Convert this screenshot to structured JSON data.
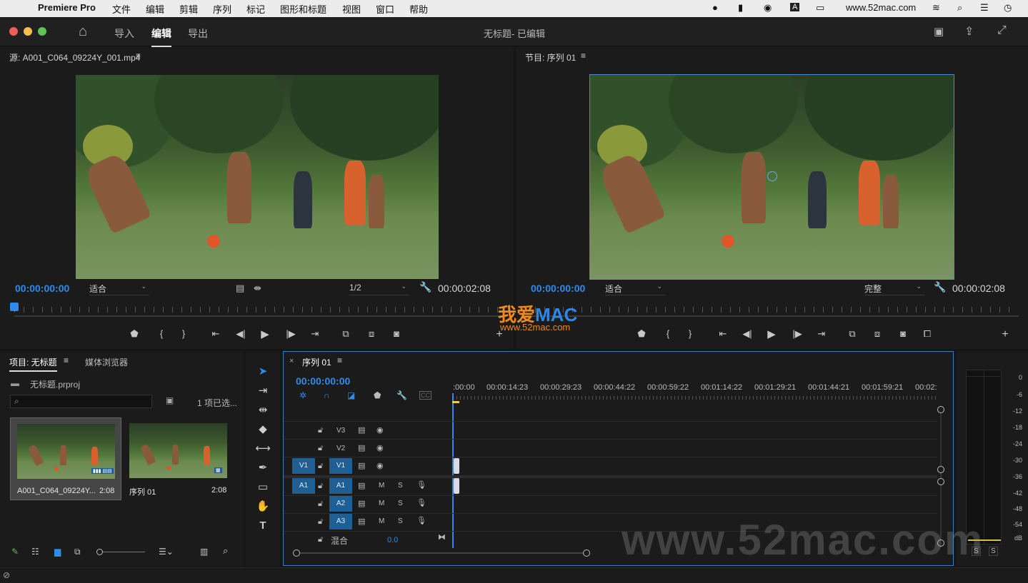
{
  "menubar": {
    "app": "Premiere Pro",
    "items": [
      "文件",
      "编辑",
      "剪辑",
      "序列",
      "标记",
      "图形和标题",
      "视图",
      "窗口",
      "帮助"
    ],
    "url": "www.52mac.com"
  },
  "titlebar": {
    "tabs": [
      "导入",
      "编辑",
      "导出"
    ],
    "active_tab": "编辑",
    "doc_title": "无标题- 已编辑"
  },
  "source": {
    "title": "源: A001_C064_09224Y_001.mp4",
    "timecode": "00:00:00:00",
    "zoom": "适合",
    "resolution": "1/2",
    "duration": "00:00:02:08"
  },
  "program": {
    "title": "节目: 序列 01",
    "timecode": "00:00:00:00",
    "zoom": "适合",
    "quality": "完整",
    "duration": "00:00:02:08"
  },
  "watermark": {
    "brand_cn": "我爱",
    "brand_en": "MAC",
    "url": "www.52mac.com",
    "big": "www.52mac.com"
  },
  "project": {
    "tab": "项目: 无标题",
    "tab2": "媒体浏览器",
    "file": "无标题.prproj",
    "selected_count": "1 项已选...",
    "items": [
      {
        "name": "A001_C064_09224Y...",
        "dur": "2:08"
      },
      {
        "name": "序列 01",
        "dur": "2:08"
      }
    ]
  },
  "timeline": {
    "tab": "序列 01",
    "timecode": "00:00:00:00",
    "ruler": [
      ":00:00",
      "00:00:14:23",
      "00:00:29:23",
      "00:00:44:22",
      "00:00:59:22",
      "00:01:14:22",
      "00:01:29:21",
      "00:01:44:21",
      "00:01:59:21",
      "00:02:"
    ],
    "tracks": {
      "v3": "V3",
      "v2": "V2",
      "v1": "V1",
      "a1": "A1",
      "a2": "A2",
      "a3": "A3",
      "src_v1": "V1",
      "src_a1": "A1",
      "mix": "混合",
      "mix_val": "0.0",
      "m": "M",
      "s": "S"
    }
  },
  "meter": {
    "scale": [
      "0",
      "-6",
      "-12",
      "-18",
      "-24",
      "-30",
      "-36",
      "-42",
      "-48",
      "-54",
      "dB"
    ],
    "solo": [
      "S",
      "S"
    ]
  },
  "colors": {
    "accent": "#2d8ceb",
    "track_btn": "#1f5f93",
    "panel_border": "#3a7cc4"
  }
}
